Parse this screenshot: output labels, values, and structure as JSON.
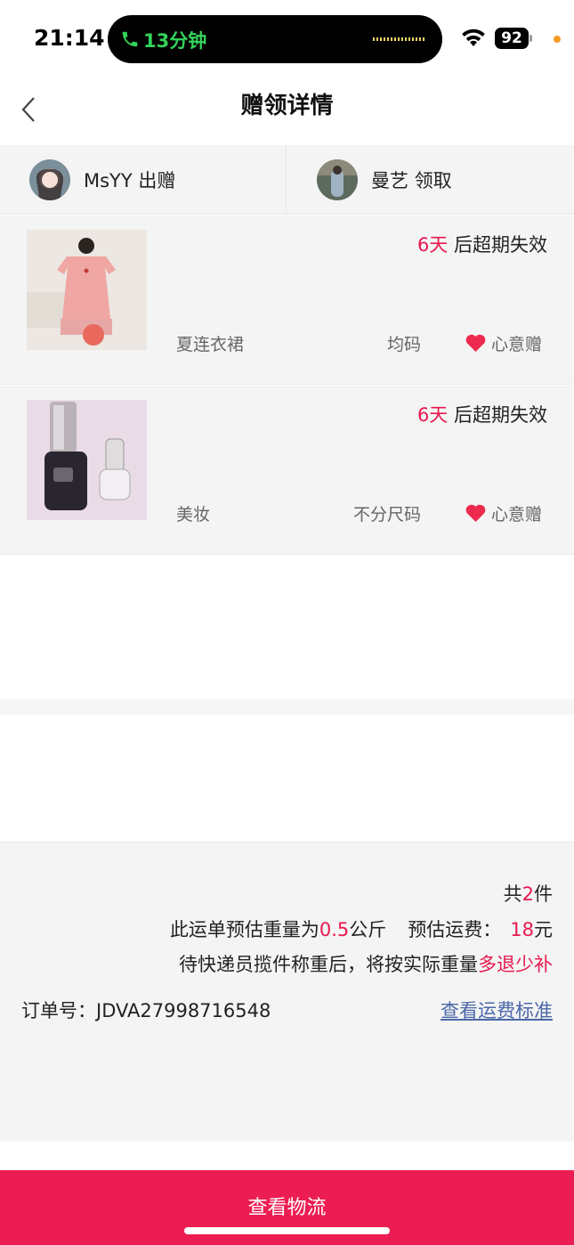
{
  "status_bar": {
    "time": "21:14",
    "call_duration": "13分钟",
    "battery": "92"
  },
  "nav": {
    "title": "赠领详情"
  },
  "users": {
    "giver": {
      "name": "MsYY",
      "action": "出赠"
    },
    "receiver": {
      "name": "曼艺",
      "action": "领取"
    }
  },
  "items": [
    {
      "expire_days": "6天",
      "expire_suffix": " 后超期失效",
      "category": "夏连衣裙",
      "size": "均码",
      "tag": "心意赠",
      "thumb": "dress-photo"
    },
    {
      "expire_days": "6天",
      "expire_suffix": " 后超期失效",
      "category": "美妆",
      "size": "不分尺码",
      "tag": "心意赠",
      "thumb": "nail-polish-photo"
    }
  ],
  "summary": {
    "count_prefix": "共",
    "count": "2",
    "count_suffix": "件",
    "weight_prefix": "此运单预估重量为",
    "weight": "0.5",
    "weight_unit": "公斤",
    "fee_label": "预估运费：",
    "fee": "18",
    "fee_unit": "元",
    "note_prefix": "待快递员揽件称重后，将按实际重量",
    "note_highlight": "多退少补",
    "order_label": "订单号：",
    "order_number": "JDVA27998716548",
    "fee_link": "查看运费标准"
  },
  "bottom_button": "查看物流",
  "colors": {
    "accent": "#ec1d52",
    "accent_text": "#e8194f",
    "link": "#4a67a8",
    "call_green": "#33d35a"
  }
}
